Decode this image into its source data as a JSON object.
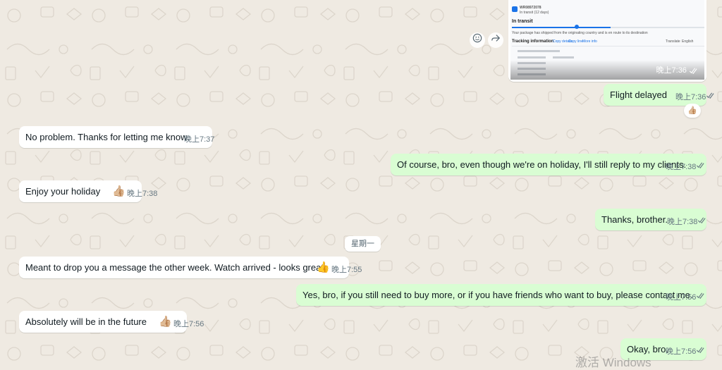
{
  "image_message": {
    "header_code": "WR08972078",
    "header_sub": "In transit (12 days)",
    "status_title": "In transit",
    "status_desc": "Your package has shipped from the originating country and is en route to its destination",
    "tracking_title": "Tracking information",
    "copy_details": "Copy details",
    "copy_line": "Copy line",
    "more_info": "More info",
    "translate_label": "Translate",
    "lang_value": "English",
    "time": "晚上7:36"
  },
  "messages": [
    {
      "dir": "out",
      "text": "Flight delayed",
      "time": "晚上7:36",
      "ticks": true
    },
    {
      "dir": "in",
      "text": "No problem. Thanks for letting me know.",
      "time": "晚上7:37"
    },
    {
      "dir": "out",
      "text": "Of course, bro, even though we're on holiday, I'll still reply to my clients.",
      "time": "晚上7:38",
      "ticks": true
    },
    {
      "dir": "in",
      "text": "Enjoy your holiday",
      "time": "晚上7:38",
      "emoji": "👍🏼"
    },
    {
      "dir": "out",
      "text": "Thanks, brother.",
      "time": "晚上7:38",
      "ticks": true
    },
    {
      "dir": "in",
      "text": "Meant to drop you a message the other week. Watch arrived - looks great",
      "time": "晚上7:55",
      "emoji": "👍"
    },
    {
      "dir": "out",
      "text": "Yes, bro, if you still need to buy more, or if you have friends who want to buy, please contact me.",
      "time": "晚上7:56",
      "ticks": true
    },
    {
      "dir": "in",
      "text": "Absolutely will be in the future",
      "time": "晚上7:56",
      "emoji": "👍🏼"
    },
    {
      "dir": "out",
      "text": "Okay, bro.",
      "time": "晚上7:56",
      "ticks": true
    }
  ],
  "day_divider": "星期一",
  "reaction_emoji": "👍🏼",
  "watermark": "激活 Windows",
  "icons": [
    "emoji-icon",
    "forward-icon",
    "double-check-icon",
    "thumbs-up-icon"
  ],
  "colors": {
    "background": "#efeae2",
    "incoming": "#ffffff",
    "outgoing": "#d9fdd3",
    "read_ticks": "#53bdeb",
    "meta": "#667781"
  }
}
